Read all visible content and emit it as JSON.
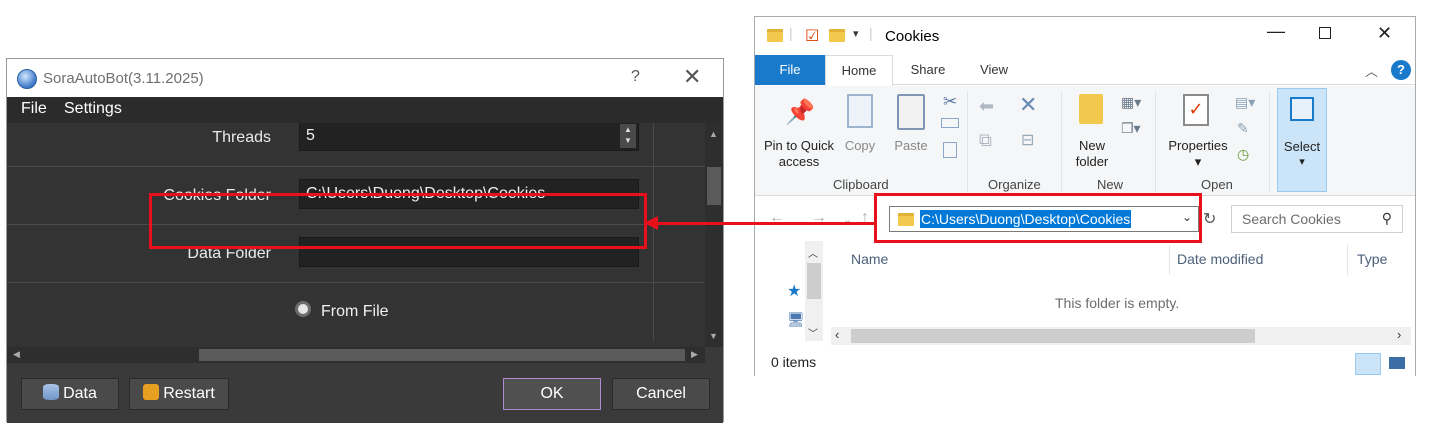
{
  "dialog": {
    "title": "SoraAutoBot(3.11.2025)",
    "help_glyph": "?",
    "close_glyph": "✕",
    "menu": [
      "File",
      "Settings"
    ],
    "fields": {
      "threads": {
        "label": "Threads",
        "value": "5"
      },
      "cookies_folder": {
        "label": "Cookies Folder",
        "value": "C:\\Users\\Duong\\Desktop\\Cookies"
      },
      "data_folder": {
        "label": "Data Folder",
        "value": ""
      },
      "from_file": {
        "label": "From File"
      }
    },
    "buttons": {
      "data": "Data",
      "restart": "Restart",
      "ok": "OK",
      "cancel": "Cancel"
    }
  },
  "explorer": {
    "title": "Cookies",
    "tabs": [
      "File",
      "Home",
      "Share",
      "View"
    ],
    "ribbon": {
      "clipboard": {
        "group": "Clipboard",
        "pin_line1": "Pin to Quick",
        "pin_line2": "access",
        "copy": "Copy",
        "paste": "Paste"
      },
      "organize": {
        "group": "Organize"
      },
      "new": {
        "group": "New",
        "new_folder_line1": "New",
        "new_folder_line2": "folder"
      },
      "open": {
        "group": "Open",
        "properties": "Properties"
      },
      "select": {
        "label": "Select"
      }
    },
    "address": "C:\\Users\\Duong\\Desktop\\Cookies",
    "search_placeholder": "Search Cookies",
    "columns": [
      "Name",
      "Date modified",
      "Type"
    ],
    "empty_message": "This folder is empty.",
    "status": "0 items"
  },
  "colors": {
    "accent_red": "#e8101a",
    "file_tab_blue": "#1979ca",
    "selection_blue": "#0078d7"
  }
}
